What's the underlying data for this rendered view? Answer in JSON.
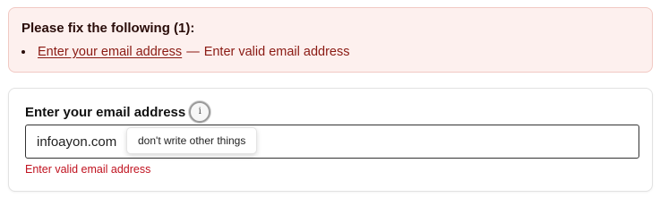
{
  "error_summary": {
    "title": "Please fix the following (1):",
    "items": [
      {
        "link_text": "Enter your email address",
        "separator": "—",
        "message": "Enter valid email address"
      }
    ]
  },
  "email_field": {
    "label": "Enter your email address",
    "info_icon_glyph": "i",
    "value": "infoayon.com",
    "tooltip": "don't write other things",
    "error": "Enter valid email address"
  },
  "colors": {
    "summary_background": "#fdf0ee",
    "summary_border": "#f1c9c3",
    "error_text": "#8a1a13",
    "field_error": "#c0121f"
  },
  "icons": {
    "info": "info-icon"
  }
}
